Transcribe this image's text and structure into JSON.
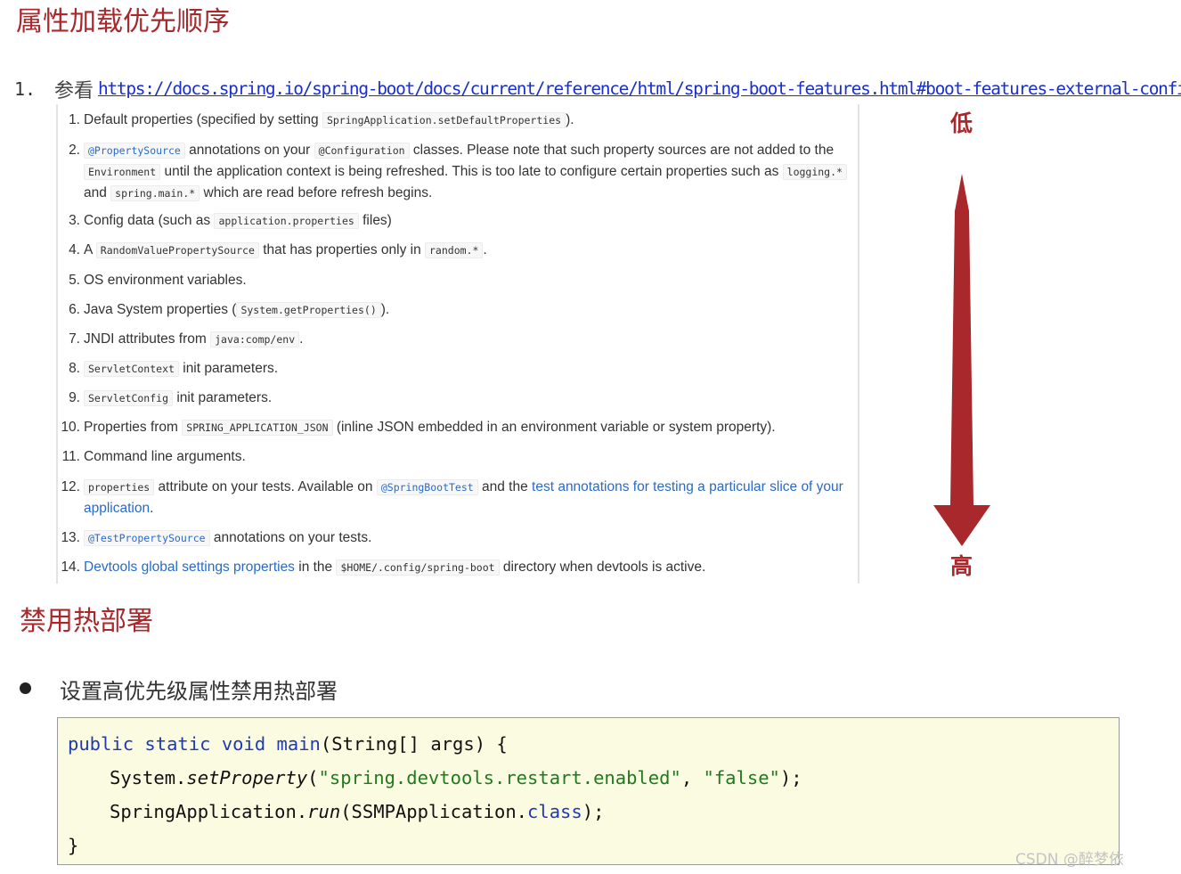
{
  "section1": {
    "title": "属性加载优先顺序",
    "ref_number": "1.",
    "ref_label": "参看",
    "ref_url": "https://docs.spring.io/spring-boot/docs/current/reference/html/spring-boot-features.html#boot-features-external-config"
  },
  "items": [
    {
      "n": "1.",
      "parts": [
        {
          "t": "Default properties (specified by setting "
        },
        {
          "t": "SpringApplication.setDefaultProperties",
          "s": "code"
        },
        {
          "t": ")."
        }
      ]
    },
    {
      "n": "2.",
      "parts": [
        {
          "t": "@PropertySource",
          "s": "code ann"
        },
        {
          "t": " annotations on your "
        },
        {
          "t": "@Configuration",
          "s": "code"
        },
        {
          "t": " classes. Please note that such property sources are not added to the "
        },
        {
          "t": "Environment",
          "s": "code"
        },
        {
          "t": " until the application context is being refreshed. This is too late to configure certain properties such as "
        },
        {
          "t": "logging.*",
          "s": "code"
        },
        {
          "t": " and "
        },
        {
          "t": "spring.main.*",
          "s": "code"
        },
        {
          "t": " which are read before refresh begins."
        }
      ]
    },
    {
      "n": "3.",
      "parts": [
        {
          "t": "Config data (such as "
        },
        {
          "t": "application.properties",
          "s": "code"
        },
        {
          "t": " files)"
        }
      ]
    },
    {
      "n": "4.",
      "parts": [
        {
          "t": "A "
        },
        {
          "t": "RandomValuePropertySource",
          "s": "code"
        },
        {
          "t": " that has properties only in "
        },
        {
          "t": "random.*",
          "s": "code"
        },
        {
          "t": "."
        }
      ]
    },
    {
      "n": "5.",
      "parts": [
        {
          "t": "OS environment variables."
        }
      ]
    },
    {
      "n": "6.",
      "parts": [
        {
          "t": "Java System properties ("
        },
        {
          "t": "System.getProperties()",
          "s": "code"
        },
        {
          "t": ")."
        }
      ]
    },
    {
      "n": "7.",
      "parts": [
        {
          "t": "JNDI attributes from "
        },
        {
          "t": "java:comp/env",
          "s": "code"
        },
        {
          "t": "."
        }
      ]
    },
    {
      "n": "8.",
      "parts": [
        {
          "t": "ServletContext",
          "s": "code"
        },
        {
          "t": " init parameters."
        }
      ]
    },
    {
      "n": "9.",
      "parts": [
        {
          "t": "ServletConfig",
          "s": "code"
        },
        {
          "t": " init parameters."
        }
      ]
    },
    {
      "n": "10.",
      "parts": [
        {
          "t": "Properties from "
        },
        {
          "t": "SPRING_APPLICATION_JSON",
          "s": "code"
        },
        {
          "t": " (inline JSON embedded in an environment variable or system property)."
        }
      ]
    },
    {
      "n": "11.",
      "parts": [
        {
          "t": "Command line arguments."
        }
      ]
    },
    {
      "n": "12.",
      "parts": [
        {
          "t": "properties",
          "s": "code"
        },
        {
          "t": " attribute on your tests. Available on "
        },
        {
          "t": "@SpringBootTest",
          "s": "code ann"
        },
        {
          "t": " and the "
        },
        {
          "t": "test annotations for testing a particular slice of your application",
          "s": "lnk"
        },
        {
          "t": "."
        }
      ]
    },
    {
      "n": "13.",
      "parts": [
        {
          "t": "@TestPropertySource",
          "s": "code ann"
        },
        {
          "t": " annotations on your tests."
        }
      ]
    },
    {
      "n": "14.",
      "parts": [
        {
          "t": "Devtools global settings properties",
          "s": "lnk"
        },
        {
          "t": " in the "
        },
        {
          "t": "$HOME/.config/spring-boot",
          "s": "code"
        },
        {
          "t": " directory when devtools is active."
        }
      ]
    }
  ],
  "arrow": {
    "low_label": "低",
    "high_label": "高",
    "color": "#a8282b"
  },
  "section2": {
    "title": "禁用热部署",
    "bullet": "设置高优先级属性禁用热部署"
  },
  "code": {
    "line1": {
      "kw1": "public",
      "kw2": "static",
      "kw3": "void",
      "fn": "main",
      "rest": "(String[] args) {"
    },
    "line2": {
      "obj": "System.",
      "method": "setProperty",
      "open": "(",
      "arg1": "\"spring.devtools.restart.enabled\"",
      "sep": ", ",
      "arg2": "\"false\"",
      "close": ");"
    },
    "line3": {
      "obj": "SpringApplication.",
      "method": "run",
      "open": "(SSMPApplication.",
      "kw": "class",
      "close": ");"
    },
    "line4": "}"
  },
  "watermark": "CSDN @醉梦依"
}
